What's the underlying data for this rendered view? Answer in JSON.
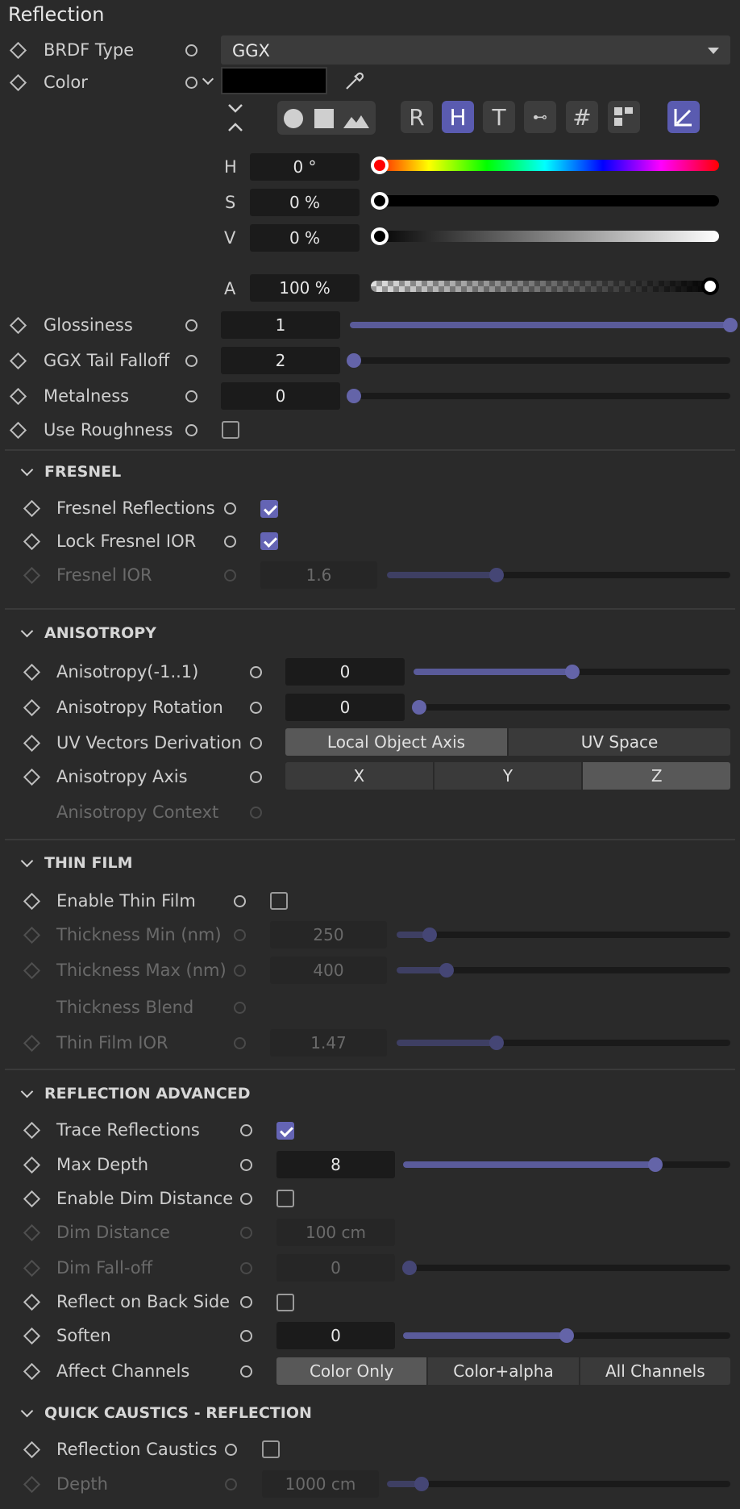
{
  "title": "Reflection",
  "brdf": {
    "label": "BRDF Type",
    "value": "GGX"
  },
  "color": {
    "label": "Color",
    "swatch": "#000000",
    "h_label": "H",
    "s_label": "S",
    "v_label": "V",
    "a_label": "A",
    "h": "0 °",
    "s": "0 %",
    "v": "0 %",
    "a": "100 %",
    "buttons": [
      "R",
      "H",
      "T"
    ],
    "active_button": "H",
    "accent": "#5a5bb0"
  },
  "params": [
    {
      "label": "Glossiness",
      "value": "1",
      "level": 1.0
    },
    {
      "label": "GGX Tail Falloff",
      "value": "2",
      "level": 0.0
    },
    {
      "label": "Metalness",
      "value": "0",
      "level": 0.0
    }
  ],
  "use_roughness": {
    "label": "Use Roughness",
    "checked": false
  },
  "fresnel": {
    "header": "FRESNEL",
    "reflections": {
      "label": "Fresnel Reflections",
      "checked": true
    },
    "lock": {
      "label": "Lock Fresnel IOR",
      "checked": true
    },
    "ior": {
      "label": "Fresnel IOR",
      "value": "1.6",
      "level": 0.32
    }
  },
  "anisotropy": {
    "header": "ANISOTROPY",
    "amount": {
      "label": "Anisotropy(-1..1)",
      "value": "0",
      "level": 0.5
    },
    "rotation": {
      "label": "Anisotropy Rotation",
      "value": "0",
      "level": 0.0
    },
    "uv": {
      "label": "UV Vectors Derivation",
      "options": [
        "Local Object Axis",
        "UV Space"
      ],
      "selected": 0
    },
    "axis": {
      "label": "Anisotropy Axis",
      "options": [
        "X",
        "Y",
        "Z"
      ],
      "selected": 2
    },
    "context": {
      "label": "Anisotropy Context"
    }
  },
  "thin_film": {
    "header": "THIN FILM",
    "enable": {
      "label": "Enable Thin Film",
      "checked": false
    },
    "min": {
      "label": "Thickness Min (nm)",
      "value": "250",
      "level": 0.1
    },
    "max": {
      "label": "Thickness Max (nm)",
      "value": "400",
      "level": 0.15
    },
    "blend": {
      "label": "Thickness Blend"
    },
    "ior": {
      "label": "Thin Film IOR",
      "value": "1.47",
      "level": 0.3
    }
  },
  "advanced": {
    "header": "REFLECTION ADVANCED",
    "trace": {
      "label": "Trace Reflections",
      "checked": true
    },
    "max_depth": {
      "label": "Max Depth",
      "value": "8",
      "level": 0.77
    },
    "enable_dim": {
      "label": "Enable Dim Distance",
      "checked": false
    },
    "dim_distance": {
      "label": "Dim Distance",
      "value": "100 cm"
    },
    "dim_falloff": {
      "label": "Dim Fall-off",
      "value": "0",
      "level": 0.0
    },
    "back_side": {
      "label": "Reflect on Back Side",
      "checked": false
    },
    "soften": {
      "label": "Soften",
      "value": "0",
      "level": 0.5
    },
    "affect": {
      "label": "Affect Channels",
      "options": [
        "Color Only",
        "Color+alpha",
        "All Channels"
      ],
      "selected": 0
    }
  },
  "caustics": {
    "header": "QUICK CAUSTICS - REFLECTION",
    "enable": {
      "label": "Reflection Caustics",
      "checked": false
    },
    "depth": {
      "label": "Depth",
      "value": "1000 cm",
      "level": 0.1
    }
  }
}
